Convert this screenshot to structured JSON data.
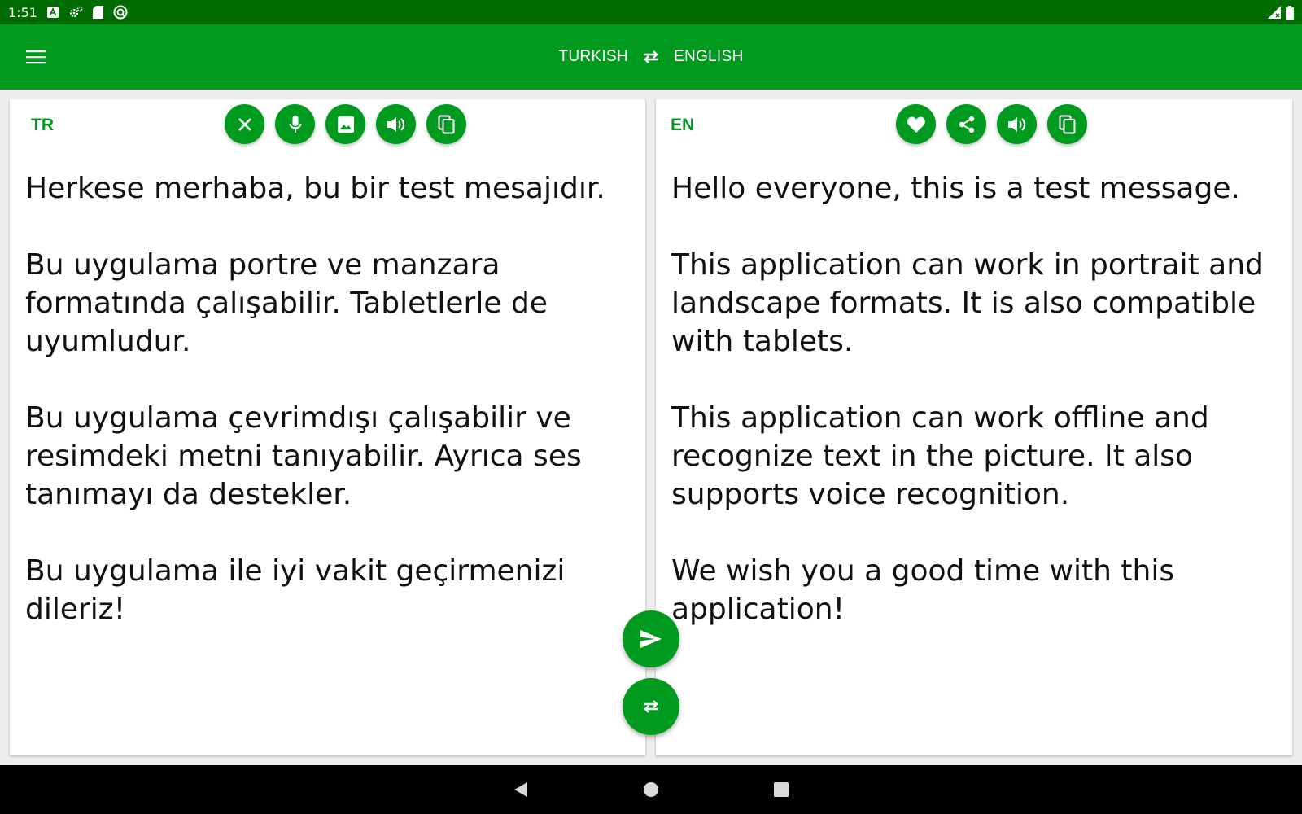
{
  "status_bar": {
    "time": "1:51",
    "icons": [
      "a-notification-icon",
      "settings-icon",
      "sd-card-icon",
      "sync-icon",
      "signal-icon",
      "battery-icon"
    ]
  },
  "app_bar": {
    "source_language": "TURKISH",
    "target_language": "ENGLISH",
    "menu_icon": "menu-icon",
    "swap_icon": "swap-icon"
  },
  "source_panel": {
    "code": "TR",
    "text": "Herkese merhaba, bu bir test mesajıdır.\n\nBu uygulama portre ve manzara formatında çalışabilir. Tabletlerle de uyumludur.\n\nBu uygulama çevrimdışı çalışabilir ve resimdeki metni tanıyabilir. Ayrıca ses tanımayı da destekler.\n\nBu uygulama ile iyi vakit geçirmenizi dileriz!",
    "tools": [
      "clear-icon",
      "microphone-icon",
      "image-icon",
      "speaker-icon",
      "copy-icon"
    ]
  },
  "target_panel": {
    "code": "EN",
    "text": "Hello everyone, this is a test message.\n\nThis application can work in portrait and landscape formats. It is also compatible with tablets.\n\nThis application can work offline and recognize text in the picture. It also supports voice recognition.\n\nWe wish you a good time with this application!",
    "tools": [
      "favorite-icon",
      "share-icon",
      "speaker-icon",
      "copy-icon"
    ]
  },
  "fabs": {
    "translate_icon": "send-icon",
    "swap_icon": "swap-icon"
  },
  "nav_bar": {
    "icons": [
      "back-icon",
      "home-icon",
      "recents-icon"
    ]
  },
  "colors": {
    "status_bar": "#006b00",
    "primary": "#009a1f",
    "panel_bg": "#ffffff",
    "text": "#111111",
    "nav_bar": "#000000"
  }
}
